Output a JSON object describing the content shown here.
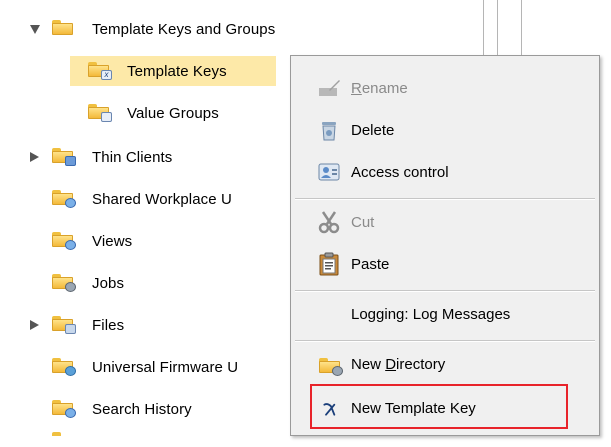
{
  "tree": {
    "items": [
      {
        "label": "Template Keys and Groups",
        "icon": "folder-icon",
        "expander": "expanded"
      },
      {
        "label": "Template Keys",
        "icon": "template-keys-folder-icon",
        "selected": true
      },
      {
        "label": "Value Groups",
        "icon": "value-groups-folder-icon"
      },
      {
        "label": "Thin Clients",
        "icon": "thin-clients-folder-icon",
        "expander": "collapsed"
      },
      {
        "label": "Shared Workplace U",
        "icon": "shared-workplace-folder-icon"
      },
      {
        "label": "Views",
        "icon": "views-folder-icon"
      },
      {
        "label": "Jobs",
        "icon": "jobs-folder-icon"
      },
      {
        "label": "Files",
        "icon": "files-folder-icon",
        "expander": "collapsed"
      },
      {
        "label": "Universal Firmware U",
        "icon": "firmware-folder-icon"
      },
      {
        "label": "Search History",
        "icon": "search-history-folder-icon"
      }
    ]
  },
  "context_menu": {
    "rename": {
      "pre": "",
      "u": "R",
      "post": "ename",
      "enabled": false,
      "icon": "rename-icon"
    },
    "delete": {
      "label": "Delete",
      "icon": "delete-icon"
    },
    "access_control": {
      "label": "Access control",
      "icon": "access-control-icon"
    },
    "cut": {
      "label": "Cut",
      "enabled": false,
      "icon": "cut-icon"
    },
    "paste": {
      "label": "Paste",
      "icon": "paste-icon"
    },
    "logging": {
      "label": "Logging: Log Messages"
    },
    "new_directory": {
      "pre": "New ",
      "u": "D",
      "post": "irectory",
      "icon": "new-directory-icon"
    },
    "new_template_key": {
      "label": "New Template Key",
      "icon": "template-key-icon"
    }
  },
  "colors": {
    "selection": "#fde9a8",
    "highlight_box": "#e8232a",
    "menu_background": "#f0f0f0"
  }
}
